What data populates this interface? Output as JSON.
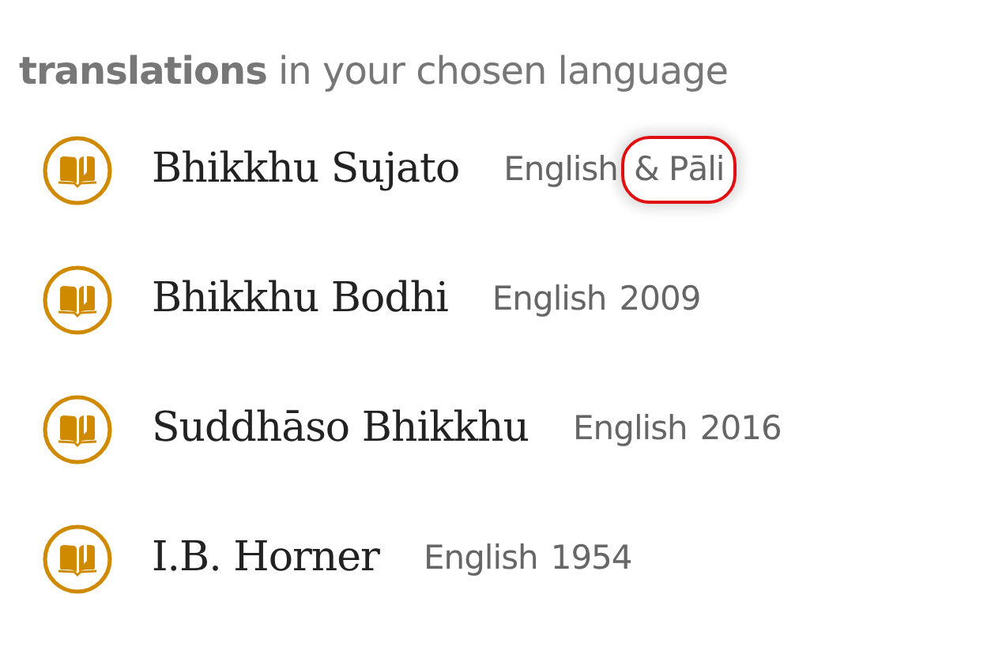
{
  "heading": {
    "bold": "translations",
    "rest": "in your chosen language"
  },
  "translations": [
    {
      "name": "Bhikkhu Sujato",
      "language": "English",
      "detail": "& Pāli",
      "highlighted": true
    },
    {
      "name": "Bhikkhu Bodhi",
      "language": "English",
      "detail": "2009",
      "highlighted": false
    },
    {
      "name": "Suddhāso Bhikkhu",
      "language": "English",
      "detail": "2016",
      "highlighted": false
    },
    {
      "name": "I.B. Horner",
      "language": "English",
      "detail": "1954",
      "highlighted": false
    }
  ]
}
